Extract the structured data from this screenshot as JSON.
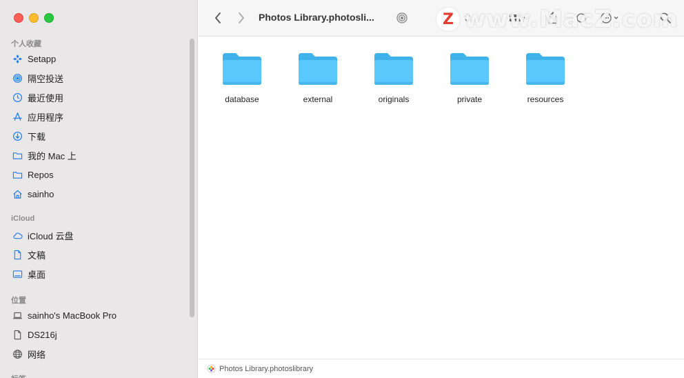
{
  "window": {
    "title": "Photos Library.photosli...",
    "watermark_badge": "Z",
    "watermark_text": "www.MacZ.com"
  },
  "sidebar": {
    "favorites_header": "个人收藏",
    "favorites": [
      {
        "label": "Setapp",
        "icon": "setapp-icon"
      },
      {
        "label": "隔空投送",
        "icon": "airdrop-icon"
      },
      {
        "label": "最近使用",
        "icon": "clock-icon"
      },
      {
        "label": "应用程序",
        "icon": "applications-icon"
      },
      {
        "label": "下载",
        "icon": "download-icon"
      },
      {
        "label": "我的 Mac 上",
        "icon": "folder-icon"
      },
      {
        "label": "Repos",
        "icon": "folder-icon"
      },
      {
        "label": "sainho",
        "icon": "home-icon"
      }
    ],
    "icloud_header": "iCloud",
    "icloud": [
      {
        "label": "iCloud 云盘",
        "icon": "cloud-icon"
      },
      {
        "label": "文稿",
        "icon": "document-icon"
      },
      {
        "label": "桌面",
        "icon": "desktop-icon"
      }
    ],
    "locations_header": "位置",
    "locations": [
      {
        "label": "sainho's MacBook Pro",
        "icon": "laptop-icon"
      },
      {
        "label": "DS216j",
        "icon": "document-icon"
      },
      {
        "label": "网络",
        "icon": "globe-icon"
      }
    ],
    "tags_header": "标签"
  },
  "folders": [
    {
      "name": "database"
    },
    {
      "name": "external"
    },
    {
      "name": "originals"
    },
    {
      "name": "private"
    },
    {
      "name": "resources"
    }
  ],
  "pathbar": {
    "label": "Photos Library.photoslibrary"
  },
  "colors": {
    "folder": "#5ac8fa",
    "accent": "#1f7cf0"
  }
}
